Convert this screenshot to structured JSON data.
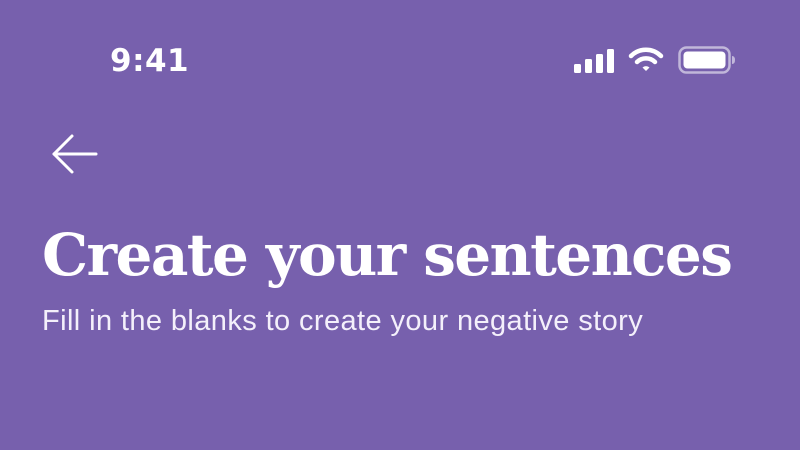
{
  "status_bar": {
    "time": "9:41",
    "signal_icon": "cellular-signal-icon",
    "wifi_icon": "wifi-icon",
    "battery_icon": "battery-icon"
  },
  "header": {
    "back_icon": "arrow-left-icon"
  },
  "main": {
    "title": "Create your sentences",
    "subtitle": "Fill in the blanks to create your negative story"
  },
  "colors": {
    "background": "#7760ad",
    "text": "#ffffff"
  }
}
